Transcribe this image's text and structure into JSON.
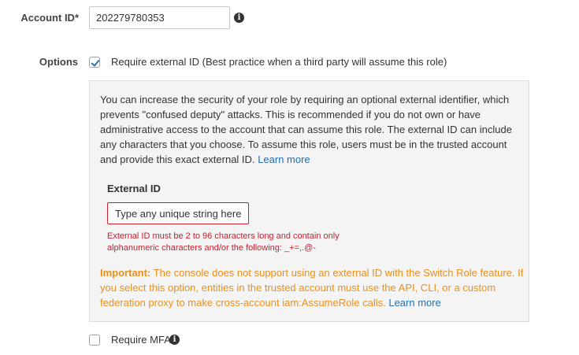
{
  "account": {
    "label": "Account ID*",
    "value": "202279780353"
  },
  "options": {
    "label": "Options",
    "require_external_id": {
      "checked": true,
      "label": "Require external ID (Best practice when a third party will assume this role)"
    },
    "panel": {
      "description": "You can increase the security of your role by requiring an optional external identifier, which prevents \"confused deputy\" attacks. This is recommended if you do not own or have administrative access to the account that can assume this role. The external ID can include any characters that you choose. To assume this role, users must be in the trusted account and provide this exact external ID.",
      "learn_more": "Learn more",
      "external_id_title": "External ID",
      "external_id_placeholder": "Type any unique string here",
      "external_id_value": "",
      "error": "External ID must be 2 to 96 characters long and contain only alphanumeric characters and/or the following: _+=,.@-",
      "important_prefix": "Important:",
      "important_text": "The console does not support using an external ID with the Switch Role feature. If you select this option, entities in the trusted account must use the API, CLI, or a custom federation proxy to make cross-account iam:AssumeRole calls.",
      "important_learn_more": "Learn more"
    },
    "require_mfa": {
      "checked": false,
      "label": "Require MFA"
    }
  },
  "icons": {
    "info": "info-icon",
    "checkmark": "checkmark-icon"
  },
  "colors": {
    "link": "#1f6fb2",
    "error": "#c8202d",
    "warning": "#e8901a",
    "panel_background": "#f4f4f4"
  }
}
